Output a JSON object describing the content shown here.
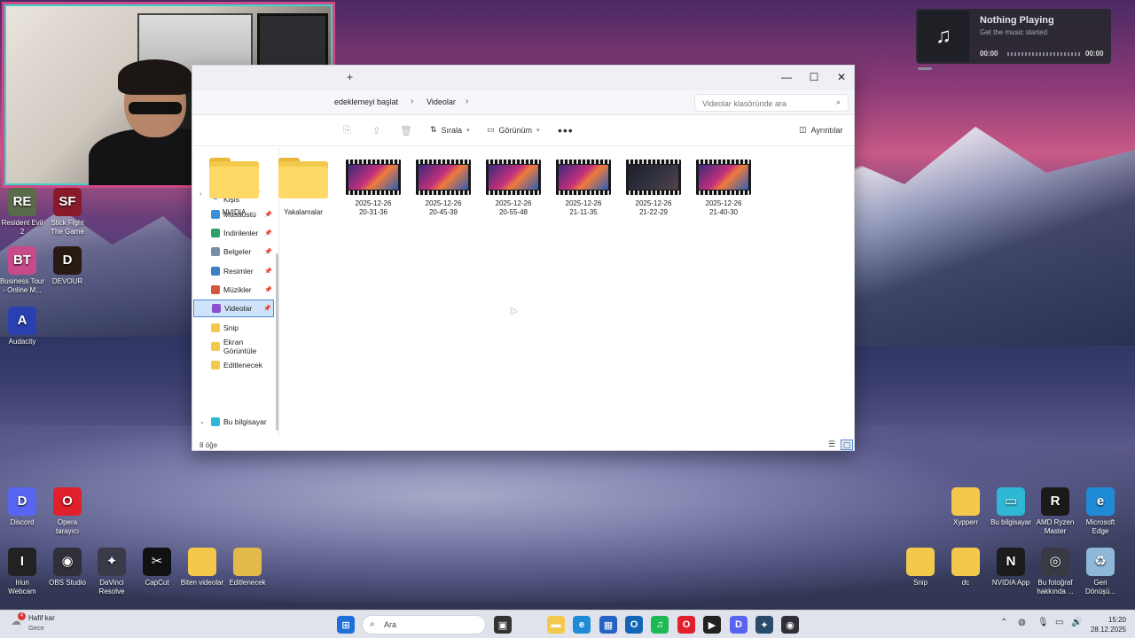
{
  "webcam": {
    "label": "webcam overlay"
  },
  "media": {
    "title": "Nothing Playing",
    "subtitle": "Get the music started",
    "time_start": "00:00",
    "time_end": "00:00",
    "icon": "music-note-icon"
  },
  "explorer": {
    "newtab": "+",
    "window_buttons": {
      "minimize": "—",
      "maximize": "☐",
      "close": "✕"
    },
    "breadcrumb": [
      "edeklemeyi başlat",
      "Videolar"
    ],
    "search_placeholder": "Videolar klasöründe ara",
    "toolbar": {
      "sort": "Sırala",
      "view": "Görünüm",
      "more": "•••",
      "details": "Ayrıntılar"
    },
    "nav": {
      "top_item": "Murathan - Kişis",
      "items": [
        {
          "label": "Masaüstü",
          "pinned": true,
          "color": "#3b8fd6"
        },
        {
          "label": "İndirilenler",
          "pinned": true,
          "color": "#2e9e6a"
        },
        {
          "label": "Belgeler",
          "pinned": true,
          "color": "#7a8ea8"
        },
        {
          "label": "Resimler",
          "pinned": true,
          "color": "#3a7fc4"
        },
        {
          "label": "Müzikler",
          "pinned": true,
          "color": "#d2583f"
        },
        {
          "label": "Videolar",
          "pinned": true,
          "color": "#8a4fd0"
        },
        {
          "label": "Snip",
          "pinned": false,
          "color": "#f3c94c"
        },
        {
          "label": "Ekran Görüntüle",
          "pinned": false,
          "color": "#f3c94c"
        },
        {
          "label": "Editlenecek",
          "pinned": false,
          "color": "#f3c94c"
        }
      ],
      "this_pc": "Bu bilgisayar"
    },
    "files": [
      {
        "name": "NVIDIA",
        "type": "folder"
      },
      {
        "name": "Yakalamalar",
        "type": "folder"
      },
      {
        "name": "2025-12-26 20-31-36",
        "line1": "2025-12-26",
        "line2": "20-31-36",
        "type": "video"
      },
      {
        "name": "2025-12-26 20-45-39",
        "line1": "2025-12-26",
        "line2": "20-45-39",
        "type": "video"
      },
      {
        "name": "2025-12-26 20-55-48",
        "line1": "2025-12-26",
        "line2": "20-55-48",
        "type": "video"
      },
      {
        "name": "2025-12-26 21-11-35",
        "line1": "2025-12-26",
        "line2": "21-11-35",
        "type": "video"
      },
      {
        "name": "2025-12-26 21-22-29",
        "line1": "2025-12-26",
        "line2": "21-22-29",
        "type": "video"
      },
      {
        "name": "2025-12-26 21-40-30",
        "line1": "2025-12-26",
        "line2": "21-40-30",
        "type": "video"
      }
    ],
    "status": "8 öğe"
  },
  "desktop_left": [
    {
      "label1": "Resident Evil",
      "label2": "2",
      "color": "#5a6b4a",
      "glyph": "RE"
    },
    {
      "label1": "Stick Fight",
      "label2": "The Game",
      "color": "#8a1a2a",
      "glyph": "SF"
    },
    {
      "label1": "Business Tour",
      "label2": "- Online M...",
      "color": "#c94a8a",
      "glyph": "BT"
    },
    {
      "label1": "DEVOUR",
      "label2": "",
      "color": "#2a1a14",
      "glyph": "D"
    },
    {
      "label1": "Audacity",
      "label2": "",
      "color": "#2a3fb0",
      "glyph": "A"
    },
    {
      "label1": "Discord",
      "label2": "",
      "color": "#5865f2",
      "glyph": "D"
    },
    {
      "label1": "Opera",
      "label2": "tarayıcı",
      "color": "#e0202a",
      "glyph": "O"
    },
    {
      "label1": "Iriun",
      "label2": "Webcam",
      "color": "#222222",
      "glyph": "I"
    },
    {
      "label1": "OBS Studio",
      "label2": "",
      "color": "#303038",
      "glyph": "◉"
    },
    {
      "label1": "DaVinci",
      "label2": "Resolve",
      "color": "#3a3a48",
      "glyph": "✦"
    },
    {
      "label1": "CapCut",
      "label2": "",
      "color": "#111111",
      "glyph": "✂"
    },
    {
      "label1": "Biten videolar",
      "label2": "",
      "color": "#f3c94c",
      "glyph": ""
    },
    {
      "label1": "Editlenecek",
      "label2": "",
      "color": "#e3b94c",
      "glyph": ""
    }
  ],
  "desktop_right": [
    {
      "label1": "Xypperr",
      "label2": "",
      "color": "#f3c94c",
      "glyph": ""
    },
    {
      "label1": "Bu bilgisayar",
      "label2": "",
      "color": "#2fb7d6",
      "glyph": "▭"
    },
    {
      "label1": "AMD Ryzen",
      "label2": "Master",
      "color": "#1a1a1a",
      "glyph": "R"
    },
    {
      "label1": "Microsoft",
      "label2": "Edge",
      "color": "#1f8ad6",
      "glyph": "e"
    },
    {
      "label1": "Snip",
      "label2": "",
      "color": "#f3c94c",
      "glyph": ""
    },
    {
      "label1": "dc",
      "label2": "",
      "color": "#f3c94c",
      "glyph": ""
    },
    {
      "label1": "NVIDIA App",
      "label2": "",
      "color": "#1c1c1c",
      "glyph": "N"
    },
    {
      "label1": "Bu fotoğraf",
      "label2": "hakkında ...",
      "color": "#3a3a44",
      "glyph": "◎"
    },
    {
      "label1": "Geri",
      "label2": "Dönüşü...",
      "color": "#8fb8d8",
      "glyph": "♻"
    }
  ],
  "taskbar": {
    "weather_main": "Hafif kar",
    "weather_sub": "Gece",
    "weather_badge": "4",
    "search_label": "Ara",
    "time": "15:20",
    "date": "28.12.2025",
    "apps": [
      {
        "name": "start-button",
        "color": "#1e6fd9",
        "glyph": "⊞"
      },
      {
        "name": "task-view",
        "color": "#333",
        "glyph": "▣"
      },
      {
        "name": "explorer-app",
        "color": "#f3c94c",
        "glyph": "▬"
      },
      {
        "name": "edge-app",
        "color": "#1f8ad6",
        "glyph": "e"
      },
      {
        "name": "store-app",
        "color": "#2463c4",
        "glyph": "▦"
      },
      {
        "name": "outlook-app",
        "color": "#1266b8",
        "glyph": "O"
      },
      {
        "name": "spotify-app",
        "color": "#1db954",
        "glyph": "♫"
      },
      {
        "name": "opera-app",
        "color": "#e0202a",
        "glyph": "O"
      },
      {
        "name": "capcut-app",
        "color": "#222",
        "glyph": "▶"
      },
      {
        "name": "discord-app",
        "color": "#5865f2",
        "glyph": "D"
      },
      {
        "name": "game-app",
        "color": "#2a4a6a",
        "glyph": "✦"
      },
      {
        "name": "obs-app",
        "color": "#303038",
        "glyph": "◉"
      }
    ]
  }
}
